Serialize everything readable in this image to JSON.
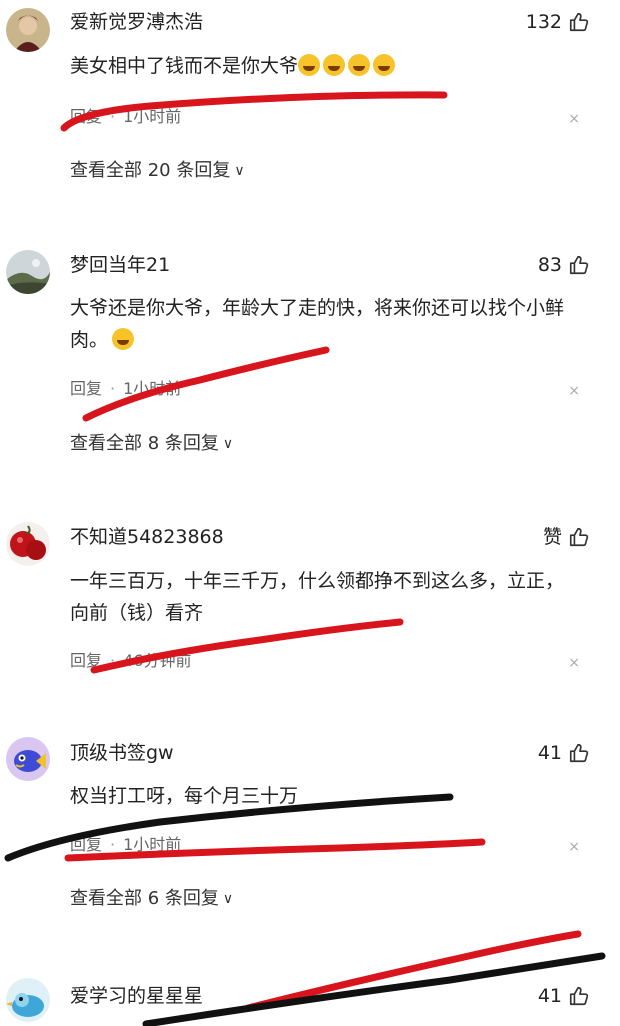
{
  "comments": [
    {
      "username": "爱新觉罗溥杰浩",
      "likes": "132",
      "text": "美女相中了钱而不是你大爷",
      "emoji_count": 4,
      "reply_label": "回复",
      "time": "1小时前",
      "view_all": "查看全部 20 条回复",
      "avatar_icon": "portrait-avatar"
    },
    {
      "username": "梦回当年21",
      "likes": "83",
      "text": "大爷还是你大爷，年龄大了走的快，将来你还可以找个小鲜肉。",
      "emoji_count": 1,
      "reply_label": "回复",
      "time": "1小时前",
      "view_all": "查看全部 8 条回复",
      "avatar_icon": "landscape-avatar"
    },
    {
      "username": "不知道54823868",
      "likes": "赞",
      "text": "一年三百万，十年三千万，什么领都挣不到这么多，立正，向前（钱）看齐",
      "emoji_count": 0,
      "reply_label": "回复",
      "time": "46分钟前",
      "view_all": "",
      "avatar_icon": "red-berries-avatar"
    },
    {
      "username": "顶级书签gw",
      "likes": "41",
      "text": "权当打工呀，每个月三十万",
      "emoji_count": 0,
      "reply_label": "回复",
      "time": "1小时前",
      "view_all": "查看全部 6 条回复",
      "avatar_icon": "cartoon-fish-avatar"
    },
    {
      "username": "爱学习的星星星",
      "likes": "41",
      "text": "",
      "emoji_count": 0,
      "reply_label": "",
      "time": "",
      "view_all": "",
      "avatar_icon": "cartoon-bird-avatar"
    }
  ],
  "icons": {
    "like": "thumbs-up-icon",
    "close": "close-icon",
    "chevron": "chevron-down-icon"
  },
  "colors": {
    "annotation_red": "#d8141c",
    "annotation_black": "#111111",
    "text": "#222222",
    "meta": "#666666"
  },
  "glyphs": {
    "dot": "·",
    "close": "×",
    "chevron": "∨"
  }
}
